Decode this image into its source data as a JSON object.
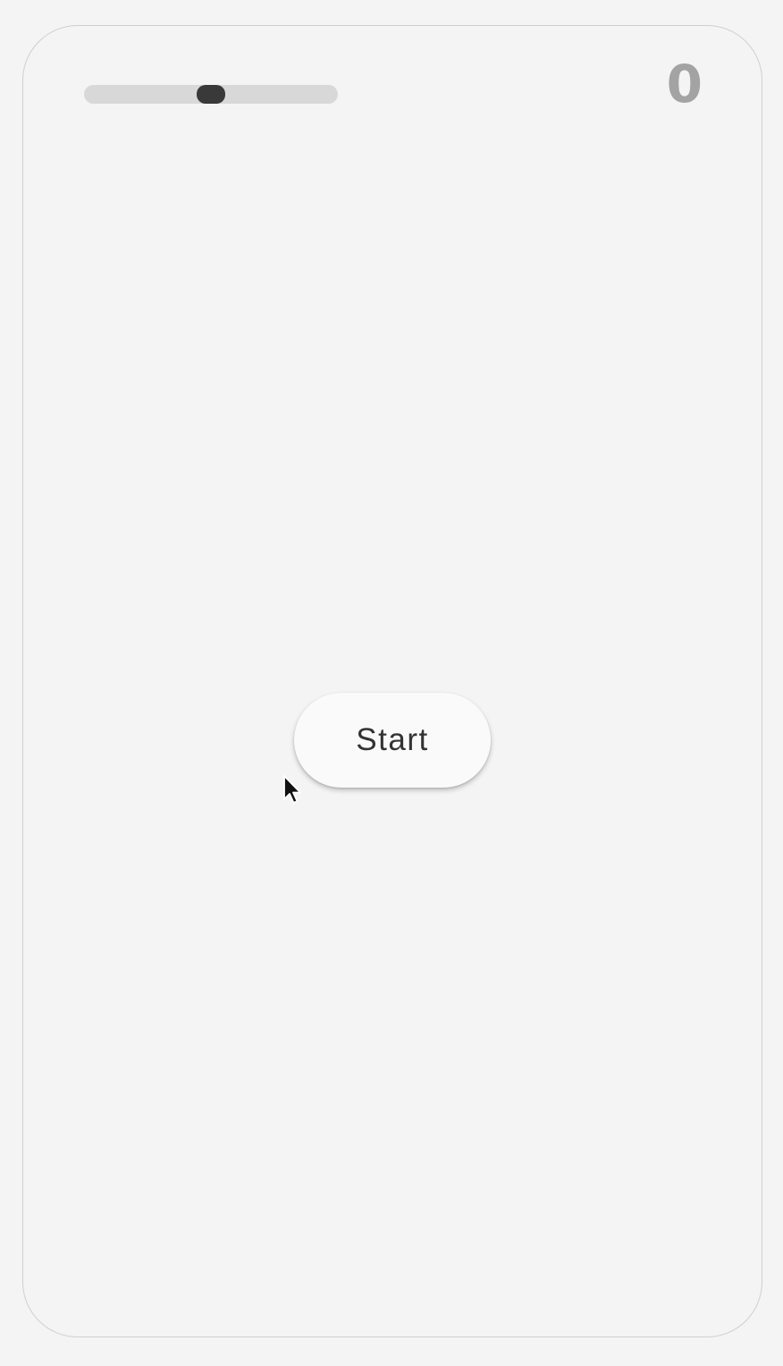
{
  "game": {
    "score": "0",
    "progress": 0.5,
    "start_label": "Start"
  },
  "colors": {
    "track": "#d8d8d8",
    "thumb": "#393939",
    "score": "#a3a3a3",
    "button": "#fafafa"
  },
  "icons": {
    "cursor": "mouse-pointer-icon"
  }
}
